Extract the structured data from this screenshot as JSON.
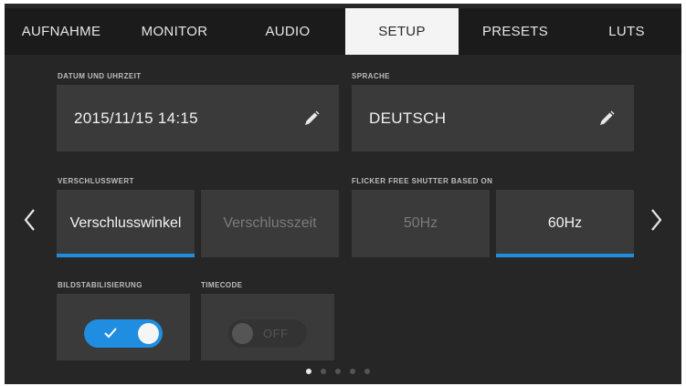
{
  "tabs": [
    {
      "label": "AUFNAHME",
      "active": false
    },
    {
      "label": "MONITOR",
      "active": false
    },
    {
      "label": "AUDIO",
      "active": false
    },
    {
      "label": "SETUP",
      "active": true
    },
    {
      "label": "PRESETS",
      "active": false
    },
    {
      "label": "LUTS",
      "active": false
    }
  ],
  "date_time": {
    "label": "DATUM UND UHRZEIT",
    "value": "2015/11/15  14:15",
    "edit_icon": "pencil-icon"
  },
  "language": {
    "label": "SPRACHE",
    "value": "DEUTSCH",
    "edit_icon": "pencil-icon"
  },
  "shutter": {
    "label": "VERSCHLUSSWERT",
    "options": [
      "Verschlusswinkel",
      "Verschlusszeit"
    ],
    "selected": "Verschlusswinkel"
  },
  "flicker": {
    "label": "FLICKER FREE SHUTTER BASED ON",
    "options": [
      "50Hz",
      "60Hz"
    ],
    "selected": "60Hz"
  },
  "stabilization": {
    "label": "BILDSTABILISIERUNG",
    "state": "on"
  },
  "timecode": {
    "label": "TIMECODE",
    "state_text": "OFF",
    "state": "off"
  },
  "navigation": {
    "prev_icon": "chevron-left-icon",
    "next_icon": "chevron-right-icon"
  },
  "pagination": {
    "total": 5,
    "current": 1
  },
  "colors": {
    "accent": "#1f8ee0",
    "background": "#262626",
    "panel": "#3a3a3a"
  }
}
